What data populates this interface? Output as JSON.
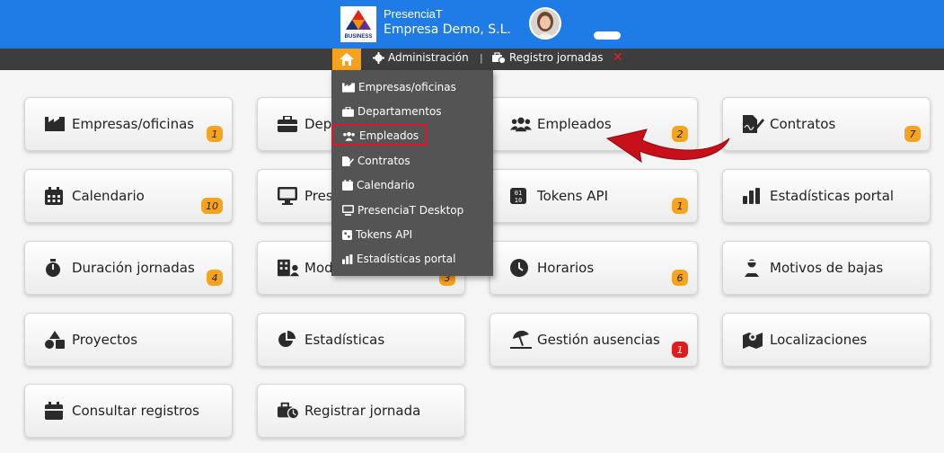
{
  "header": {
    "logo_caption": "BUSINESS",
    "app_name": "PresenciaT",
    "company_name": "Empresa Demo, S.L."
  },
  "nav": {
    "items": [
      {
        "label": "Administración",
        "icon": "gear-icon"
      },
      {
        "label": "Registro jornadas",
        "icon": "briefcase-clock-icon"
      }
    ],
    "separator": "|",
    "close_symbol": "✕"
  },
  "dropdown": {
    "items": [
      {
        "label": "Empresas/oficinas",
        "icon": "industry-icon"
      },
      {
        "label": "Departamentos",
        "icon": "briefcase-icon"
      },
      {
        "label": "Empleados",
        "icon": "users-icon",
        "highlighted": true
      },
      {
        "label": "Contratos",
        "icon": "signature-icon"
      },
      {
        "label": "Calendario",
        "icon": "calendar-icon"
      },
      {
        "label": "PresenciaT Desktop",
        "icon": "desktop-icon"
      },
      {
        "label": "Tokens API",
        "icon": "token-icon"
      },
      {
        "label": "Estadísticas portal",
        "icon": "bar-chart-icon"
      }
    ]
  },
  "tiles": [
    {
      "label": "Empresas/oficinas",
      "badge": "1",
      "icon": "industry-icon"
    },
    {
      "label": "Departamentos",
      "badge": "",
      "icon": "briefcase-icon"
    },
    {
      "label": "Empleados",
      "badge": "2",
      "icon": "users-icon"
    },
    {
      "label": "Contratos",
      "badge": "7",
      "icon": "signature-icon"
    },
    {
      "label": "Calendario",
      "badge": "10",
      "icon": "calendar-icon"
    },
    {
      "label": "PresenciaT Desktop",
      "badge": "",
      "icon": "desktop-icon"
    },
    {
      "label": "Tokens API",
      "badge": "1",
      "icon": "token-icon"
    },
    {
      "label": "Estadísticas portal",
      "badge": "",
      "icon": "bar-chart-icon"
    },
    {
      "label": "Duración jornadas",
      "badge": "4",
      "icon": "stopwatch-icon"
    },
    {
      "label": "Modalidades",
      "badge": "3",
      "icon": "building-user-icon"
    },
    {
      "label": "Horarios",
      "badge": "6",
      "icon": "clock-icon"
    },
    {
      "label": "Motivos de bajas",
      "badge": "",
      "icon": "user-injured-icon"
    },
    {
      "label": "Proyectos",
      "badge": "",
      "icon": "shapes-icon"
    },
    {
      "label": "Estadísticas",
      "badge": "",
      "icon": "pie-chart-icon"
    },
    {
      "label": "Gestión ausencias",
      "badge": "1",
      "badge_color": "#e11b1b",
      "icon": "umbrella-beach-icon"
    },
    {
      "label": "Localizaciones",
      "badge": "",
      "icon": "map-location-icon"
    },
    {
      "label": "Consultar registros",
      "badge": "",
      "icon": "calendar-minus-icon"
    },
    {
      "label": "Registrar jornada",
      "badge": "",
      "icon": "briefcase-clock-icon"
    }
  ],
  "colors": {
    "header_blue": "#1f7be6",
    "nav_dark": "#3d3d3d",
    "home_orange": "#f6a21e",
    "dropdown_bg": "#545454",
    "badge_orange": "#f6a41e",
    "highlight_red": "#e1162b"
  }
}
